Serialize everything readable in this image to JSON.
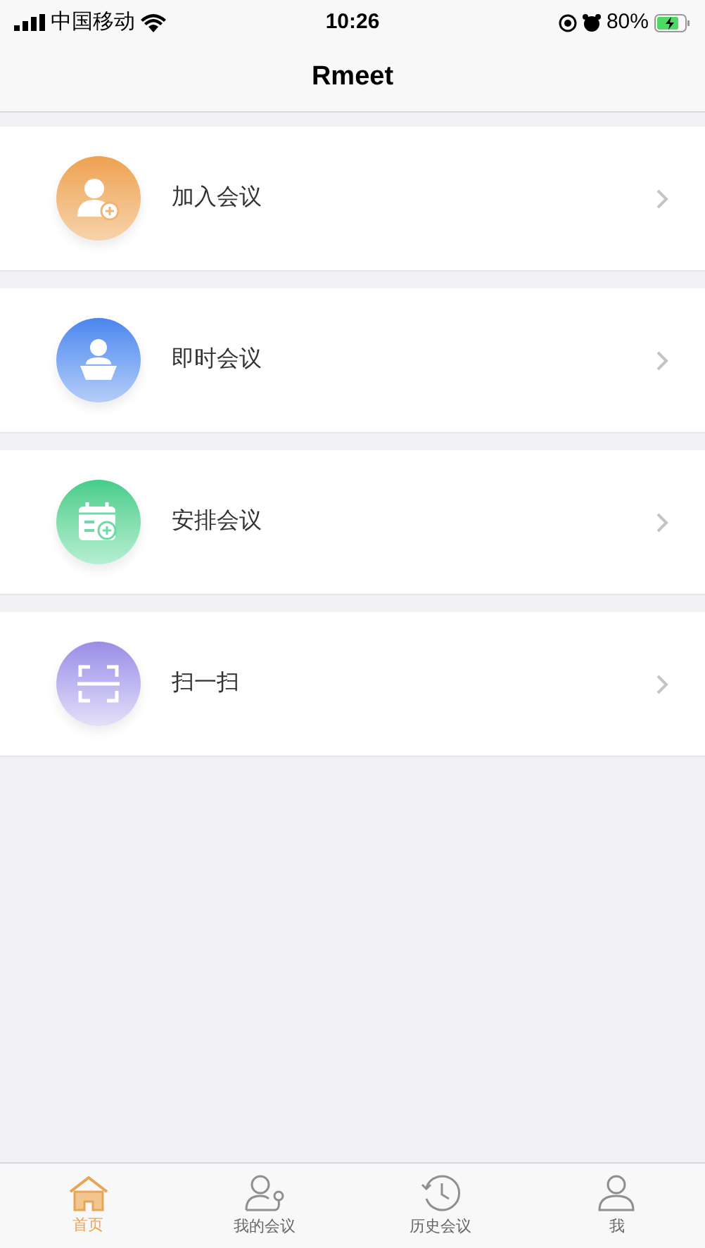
{
  "status_bar": {
    "carrier": "中国移动",
    "time": "10:26",
    "battery": "80%"
  },
  "nav_bar": {
    "title": "Rmeet"
  },
  "menu": [
    {
      "kind": "join",
      "label": "加入会议"
    },
    {
      "kind": "instant",
      "label": "即时会议"
    },
    {
      "kind": "schedule",
      "label": "安排会议"
    },
    {
      "kind": "scan",
      "label": "扫一扫"
    }
  ],
  "tab_bar": [
    {
      "kind": "home",
      "label": "首页",
      "selected": true
    },
    {
      "kind": "meetings",
      "label": "我的会议",
      "selected": false
    },
    {
      "kind": "history",
      "label": "历史会议",
      "selected": false
    },
    {
      "kind": "me",
      "label": "我",
      "selected": false
    }
  ]
}
